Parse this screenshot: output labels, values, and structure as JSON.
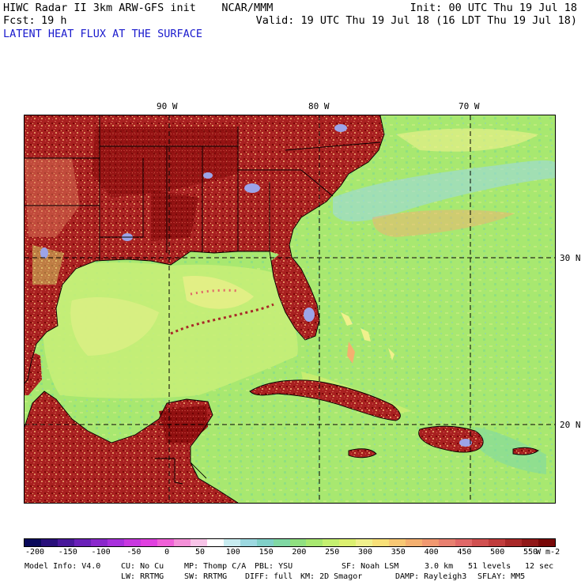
{
  "header": {
    "title": "HIWC Radar II 3km ARW-GFS init    NCAR/MMM",
    "init": "Init: 00 UTC Thu 19 Jul 18",
    "fcst_label": "Fcst:",
    "fcst_value": "19 h",
    "valid": "Valid: 19 UTC Thu 19 Jul 18 (16 LDT Thu 19 Jul 18)",
    "field": "LATENT HEAT FLUX AT THE SURFACE"
  },
  "grid": {
    "lon_labels": [
      "90 W",
      "80 W",
      "70 W"
    ],
    "lat_labels": [
      "30 N",
      "20 N"
    ]
  },
  "colorbar": {
    "tick_labels": [
      "-200",
      "-150",
      "-100",
      "-50",
      "0",
      "50",
      "100",
      "150",
      "200",
      "250",
      "300",
      "350",
      "400",
      "450",
      "500",
      "550"
    ],
    "units": "W m-2",
    "colors": [
      "#0a0a5a",
      "#28107a",
      "#48189a",
      "#6a20b8",
      "#8a28cc",
      "#a830dc",
      "#c838e0",
      "#e040e0",
      "#f060d8",
      "#f490d8",
      "#f8c4e8",
      "#ffffff",
      "#c8ecf0",
      "#9cd8e0",
      "#80d0c8",
      "#80d8a4",
      "#90e080",
      "#a8e870",
      "#c4f070",
      "#dcf070",
      "#f0f08c",
      "#f8e078",
      "#f8c874",
      "#f4b070",
      "#f09870",
      "#e88070",
      "#e06868",
      "#d05050",
      "#c03c3c",
      "#a82828",
      "#901818",
      "#780808"
    ]
  },
  "model_info": {
    "line1": [
      "Model Info: V4.0",
      "CU: No Cu",
      "MP: Thomp C/A",
      "PBL: YSU",
      "SF: Noah LSM",
      "3.0 km",
      "51 levels",
      "12 sec"
    ],
    "line2": [
      "LW: RRTMG",
      "SW: RRTMG",
      "DIFF: full",
      "KM: 2D Smagor",
      "DAMP: Rayleigh3",
      "SFLAY: MM5"
    ]
  }
}
